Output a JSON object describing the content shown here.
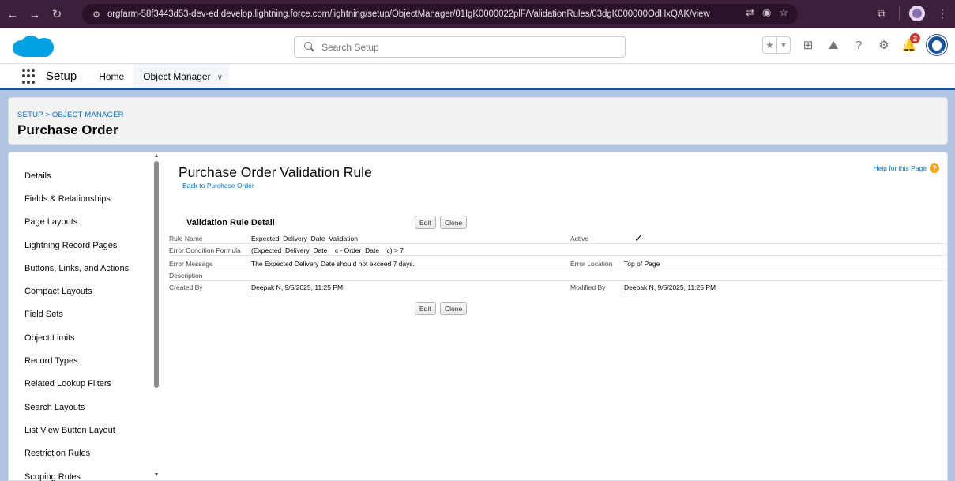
{
  "browser": {
    "url": "orgfarm-58f3443d53-dev-ed.develop.lightning.force.com/lightning/setup/ObjectManager/01IgK0000022plF/ValidationRules/03dgK000000OdHxQAK/view"
  },
  "header": {
    "search_placeholder": "Search Setup",
    "notification_count": "2"
  },
  "app_nav": {
    "app_name": "Setup",
    "tabs": [
      {
        "label": "Home"
      },
      {
        "label": "Object Manager"
      }
    ]
  },
  "page_header": {
    "breadcrumb": "SETUP > OBJECT MANAGER",
    "title": "Purchase Order"
  },
  "sidebar": {
    "items": [
      {
        "label": "Details"
      },
      {
        "label": "Fields & Relationships"
      },
      {
        "label": "Page Layouts"
      },
      {
        "label": "Lightning Record Pages"
      },
      {
        "label": "Buttons, Links, and Actions"
      },
      {
        "label": "Compact Layouts"
      },
      {
        "label": "Field Sets"
      },
      {
        "label": "Object Limits"
      },
      {
        "label": "Record Types"
      },
      {
        "label": "Related Lookup Filters"
      },
      {
        "label": "Search Layouts"
      },
      {
        "label": "List View Button Layout"
      },
      {
        "label": "Restriction Rules"
      },
      {
        "label": "Scoping Rules"
      }
    ]
  },
  "content": {
    "title": "Purchase Order Validation Rule",
    "back_link": "Back to Purchase Order",
    "help_link": "Help for this Page",
    "detail_title": "Validation Rule Detail",
    "edit_label": "Edit",
    "clone_label": "Clone",
    "fields": {
      "rule_name_label": "Rule Name",
      "rule_name_value": "Expected_Delivery_Date_Validation",
      "active_label": "Active",
      "active_value": "✓",
      "formula_label": "Error Condition Formula",
      "formula_value": "(Expected_Delivery_Date__c - Order_Date__c) > 7",
      "message_label": "Error Message",
      "message_value": "The Expected Delivery Date should not exceed 7 days.",
      "location_label": "Error Location",
      "location_value": "Top of Page",
      "description_label": "Description",
      "created_by_label": "Created By",
      "created_by_user": "Deepak N",
      "created_by_date": ", 9/5/2025, 11:25 PM",
      "modified_by_label": "Modified By",
      "modified_by_user": "Deepak N",
      "modified_by_date": ", 9/5/2025, 11:25 PM"
    }
  }
}
